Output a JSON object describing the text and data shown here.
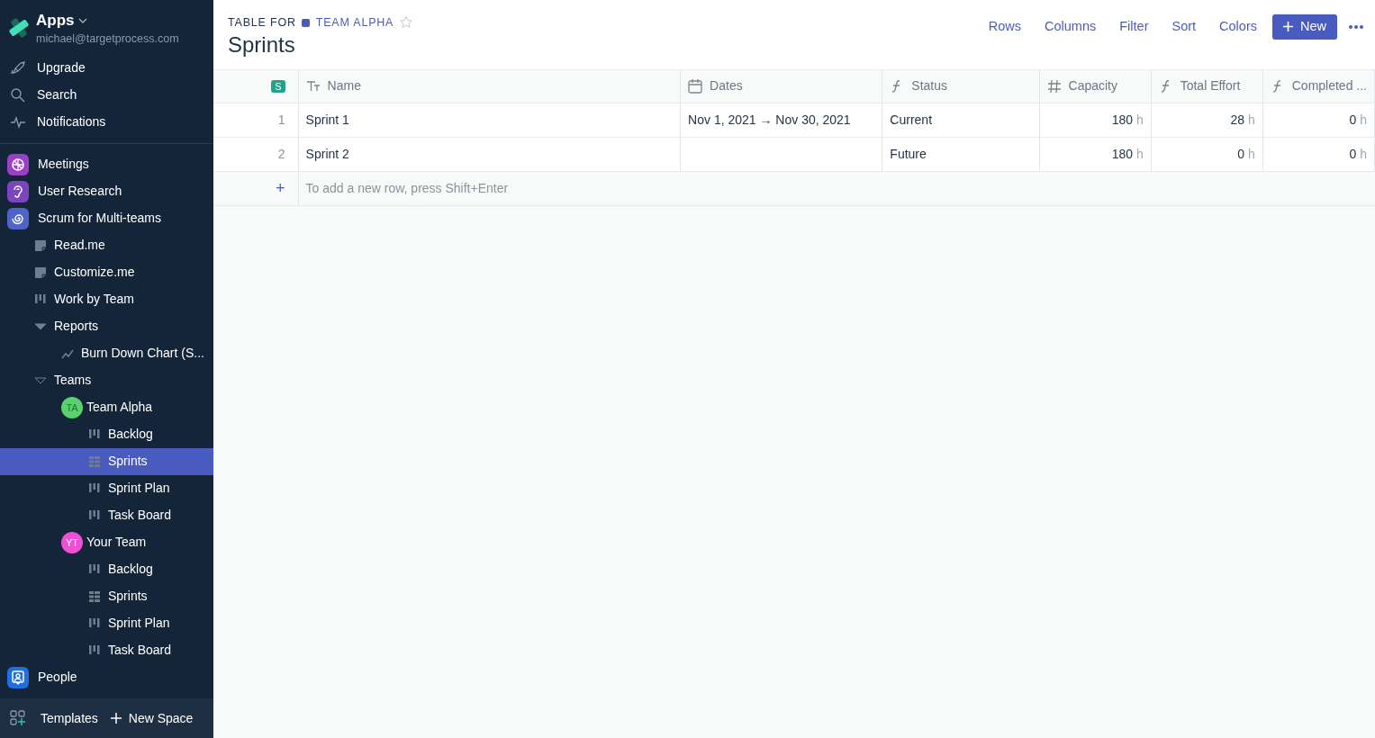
{
  "workspace": {
    "name": "Apps",
    "email": "michael@targetprocess.com"
  },
  "nav": [
    {
      "label": "Upgrade",
      "kind": "upgrade"
    },
    {
      "label": "Search",
      "kind": "search"
    },
    {
      "label": "Notifications",
      "kind": "notifications"
    }
  ],
  "spaces": [
    {
      "label": "Meetings",
      "kind": "space",
      "color": "#9b3fc4",
      "selected": false
    },
    {
      "label": "User Research",
      "kind": "space",
      "color": "#7c45c0",
      "selected": false
    },
    {
      "label": "Scrum for Multi-teams",
      "kind": "space",
      "color": "#4f63c9",
      "selected": false,
      "children": [
        {
          "label": "Read.me",
          "kind": "doc",
          "selected": false
        },
        {
          "label": "Customize.me",
          "kind": "doc",
          "selected": false
        },
        {
          "label": "Work by Team",
          "kind": "board",
          "selected": false
        },
        {
          "label": "Reports",
          "kind": "folder",
          "selected": false,
          "expanded": true,
          "children": [
            {
              "label": "Burn Down Chart (S...",
              "kind": "chart",
              "selected": false
            }
          ]
        },
        {
          "label": "Teams",
          "kind": "group",
          "selected": false,
          "expanded": true,
          "children": [
            {
              "label": "Team Alpha",
              "kind": "team",
              "initials": "TA",
              "color": "#5bd16e",
              "selected": false,
              "children": [
                {
                  "label": "Backlog",
                  "kind": "board",
                  "selected": false
                },
                {
                  "label": "Sprints",
                  "kind": "table",
                  "selected": true
                },
                {
                  "label": "Sprint Plan",
                  "kind": "board",
                  "selected": false
                },
                {
                  "label": "Task Board",
                  "kind": "board",
                  "selected": false
                }
              ]
            },
            {
              "label": "Your Team",
              "kind": "team",
              "initials": "YT",
              "color": "#ee4fd6",
              "selected": false,
              "children": [
                {
                  "label": "Backlog",
                  "kind": "board",
                  "selected": false
                },
                {
                  "label": "Sprints",
                  "kind": "table",
                  "selected": false
                },
                {
                  "label": "Sprint Plan",
                  "kind": "board",
                  "selected": false
                },
                {
                  "label": "Task Board",
                  "kind": "board",
                  "selected": false
                }
              ]
            }
          ]
        }
      ]
    },
    {
      "label": "People",
      "kind": "space",
      "color": "#1f6fe0",
      "selected": false
    }
  ],
  "footer": {
    "templates": "Templates",
    "new_space": "New Space"
  },
  "header": {
    "prefix": "TABLE FOR",
    "team": "TEAM ALPHA",
    "starred": false,
    "title": "Sprints"
  },
  "toolbar": {
    "links": [
      "Rows",
      "Columns",
      "Filter",
      "Sort",
      "Colors"
    ],
    "new_button": "New"
  },
  "table": {
    "selector": "S",
    "columns": [
      {
        "label": "Name",
        "kind": "text"
      },
      {
        "label": "Dates",
        "kind": "date"
      },
      {
        "label": "Status",
        "kind": "formula"
      },
      {
        "label": "Capacity",
        "kind": "number"
      },
      {
        "label": "Total Effort",
        "kind": "formula"
      },
      {
        "label": "Completed ...",
        "kind": "formula"
      }
    ],
    "rows": [
      {
        "index": "1",
        "cells": [
          {
            "value": "Sprint 1"
          },
          {
            "value": "Nov 1, 2021 → Nov 30, 2021"
          },
          {
            "value": "Current"
          },
          {
            "value": "180",
            "unit": "h"
          },
          {
            "value": "28",
            "unit": "h"
          },
          {
            "value": "0",
            "unit": "h"
          }
        ]
      },
      {
        "index": "2",
        "cells": [
          {
            "value": "Sprint 2"
          },
          {},
          {
            "value": "Future"
          },
          {
            "value": "180",
            "unit": "h"
          },
          {
            "value": "0",
            "unit": "h"
          },
          {
            "value": "0",
            "unit": "h"
          }
        ]
      }
    ],
    "add_row": {
      "symbol": "+",
      "hint": "To add a new row, press Shift+Enter"
    }
  }
}
